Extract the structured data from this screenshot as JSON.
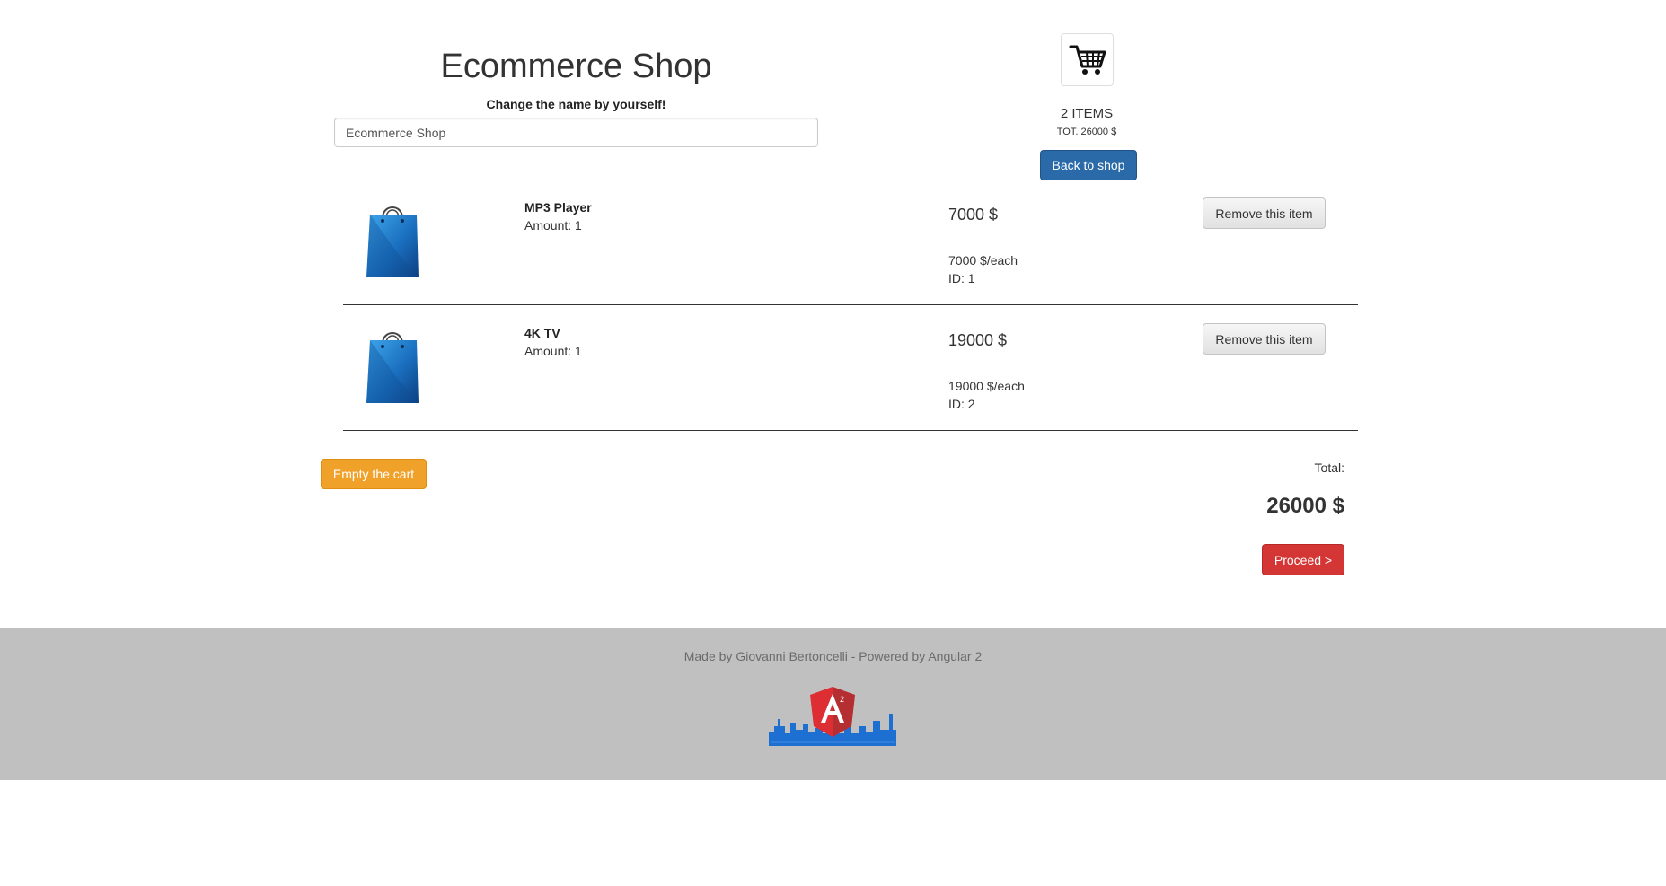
{
  "header": {
    "shop_title": "Ecommerce Shop",
    "name_hint": "Change the name by yourself!",
    "name_input_value": "Ecommerce Shop"
  },
  "cart_summary": {
    "items_label": "2 ITEMS",
    "total_label": "TOT. 26000 $",
    "back_button": "Back to shop",
    "cart_icon": "shopping-cart-icon"
  },
  "items": [
    {
      "name": "MP3 Player",
      "amount": "Amount: 1",
      "price": "7000 $",
      "each": "7000 $/each",
      "id": "ID: 1",
      "remove_label": "Remove this item",
      "icon": "shopping-bag-icon"
    },
    {
      "name": "4K TV",
      "amount": "Amount: 1",
      "price": "19000 $",
      "each": "19000 $/each",
      "id": "ID: 2",
      "remove_label": "Remove this item",
      "icon": "shopping-bag-icon"
    }
  ],
  "actions": {
    "empty_cart": "Empty the cart",
    "total_label": "Total:",
    "total_value": "26000 $",
    "proceed": "Proceed >"
  },
  "footer": {
    "credit": "Made by Giovanni Bertoncelli - Powered by Angular 2",
    "logo": "angular-2-logo"
  },
  "colors": {
    "primary_button": "#2a6aa8",
    "warning_button": "#f0a12a",
    "danger_button": "#d43535",
    "footer_bg": "#c0c0c0",
    "angular_red": "#dd2e33",
    "skyline_blue": "#1d6fd1"
  }
}
